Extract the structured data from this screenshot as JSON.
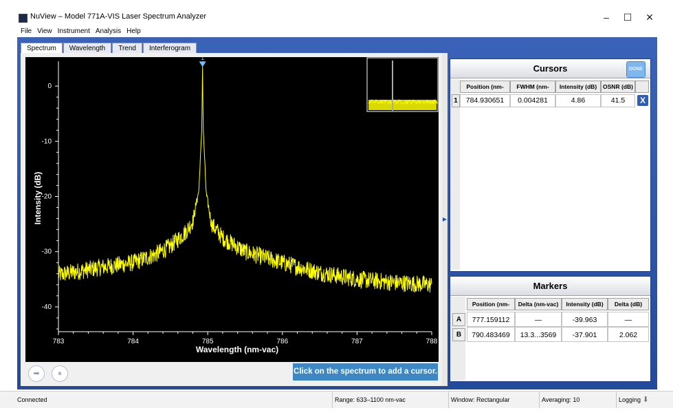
{
  "window": {
    "title": "NuView – Model 771A-VIS Laser Spectrum Analyzer",
    "minimize": "–",
    "maximize": "☐",
    "close": "✕"
  },
  "menu": [
    "File",
    "View",
    "Instrument",
    "Analysis",
    "Help"
  ],
  "tabs": [
    {
      "label": "Spectrum",
      "active": true
    },
    {
      "label": "Wavelength",
      "active": false
    },
    {
      "label": "Trend",
      "active": false
    },
    {
      "label": "Interferogram",
      "active": false
    }
  ],
  "chart_data": {
    "type": "line",
    "xlabel": "Wavelength (nm-vac)",
    "ylabel": "Intensity (dB)",
    "xlim": [
      783,
      788
    ],
    "ylim": [
      -44.5,
      4.5
    ],
    "x_ticks": [
      783,
      784,
      785,
      786,
      787,
      788
    ],
    "y_ticks": [
      0,
      -10,
      -20,
      -30,
      -40
    ],
    "grid": false,
    "background": "#000000",
    "line_color": "#ffff00",
    "series": [
      {
        "x": [
          783.0,
          783.5,
          784.0,
          784.3,
          784.5,
          784.7,
          784.8,
          784.88,
          784.92,
          784.93,
          784.94,
          784.98,
          785.05,
          785.2,
          785.5,
          786.0,
          786.5,
          787.0,
          787.5,
          788.0
        ],
        "y": [
          -34.2,
          -33.0,
          -32.0,
          -30.5,
          -29.0,
          -26.5,
          -24.5,
          -19.0,
          -8.0,
          3.6,
          -8.0,
          -19.5,
          -25.0,
          -27.5,
          -30.0,
          -32.0,
          -33.8,
          -35.0,
          -35.6,
          -36.0
        ]
      }
    ],
    "cursor": {
      "label": "1",
      "x": 784.930651,
      "color": "#6fc4ff"
    }
  },
  "controls": {
    "play_icon": "➡",
    "pause_icon": "⏸",
    "hint": "Click on the spectrum to add a cursor."
  },
  "cursors_panel": {
    "title": "Cursors",
    "done": "DONE",
    "columns": [
      "Position (nm-vac)",
      "FWHM (nm-vac)",
      "Intensity (dB)",
      "OSNR (dB)"
    ],
    "rows": [
      {
        "id": "1",
        "position": "784.930651",
        "fwhm": "0.004281",
        "intensity": "4.86",
        "osnr": "41.5",
        "delete": "X"
      }
    ]
  },
  "markers_panel": {
    "title": "Markers",
    "columns": [
      "Position (nm-vac)",
      "Delta (nm-vac)",
      "Intensity (dB)",
      "Delta (dB)"
    ],
    "rows": [
      {
        "id": "A",
        "position": "777.159112",
        "delta_nm": "—",
        "intensity": "-39.963",
        "delta_db": "—"
      },
      {
        "id": "B",
        "position": "790.483469",
        "delta_nm": "13.3...3569",
        "intensity": "-37.901",
        "delta_db": "2.062"
      }
    ]
  },
  "status": {
    "connection": "Connected",
    "range": "Range: 633–1100 nm-vac",
    "window": "Window: Rectangular",
    "averaging": "Averaging: 10",
    "logging": "Logging"
  }
}
